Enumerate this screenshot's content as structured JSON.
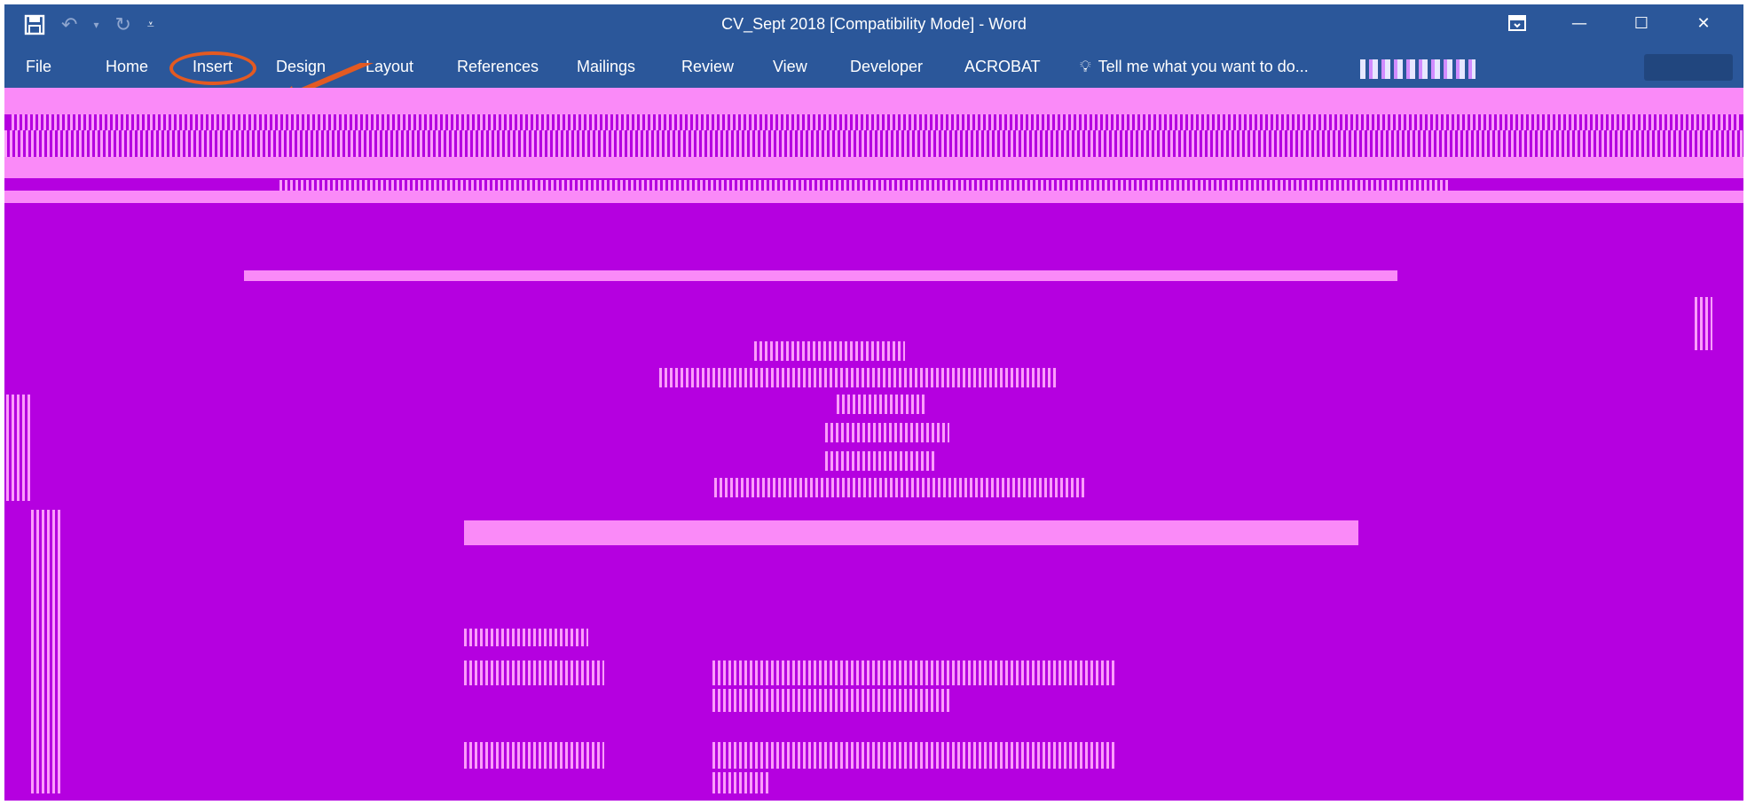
{
  "window": {
    "title": "CV_Sept 2018 [Compatibility Mode] - Word"
  },
  "quick_access": {
    "save_icon": "save-icon",
    "undo_icon": "undo-icon",
    "redo_icon": "redo-icon",
    "customize_icon": "customize-qat-icon"
  },
  "window_controls": {
    "ribbon_display_icon": "ribbon-display-options-icon",
    "minimize": "—",
    "maximize": "☐",
    "close": "✕"
  },
  "ribbon": {
    "tabs": [
      {
        "label": "File"
      },
      {
        "label": "Home"
      },
      {
        "label": "Insert",
        "highlighted": true
      },
      {
        "label": "Design"
      },
      {
        "label": "Layout"
      },
      {
        "label": "References"
      },
      {
        "label": "Mailings"
      },
      {
        "label": "Review"
      },
      {
        "label": "View"
      },
      {
        "label": "Developer"
      },
      {
        "label": "ACROBAT"
      }
    ],
    "tell_me": "Tell me what you want to do...",
    "tell_me_icon": "lightbulb-icon"
  },
  "colors": {
    "title_bar": "#2b579a",
    "annotation": "#e35a22",
    "corrupted_fill": "#b500e0",
    "corrupted_band": "#fa8af8"
  }
}
